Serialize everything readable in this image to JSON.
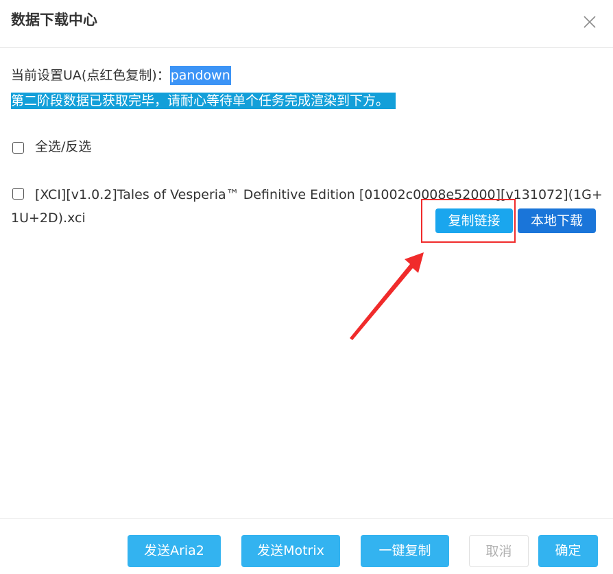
{
  "dialog": {
    "title": "数据下载中心"
  },
  "ua": {
    "label": "当前设置UA(点红色复制)：",
    "value": "pandown"
  },
  "status": {
    "message": "第二阶段数据已获取完毕，请耐心等待单个任务完成渲染到下方。"
  },
  "select_all": {
    "label": "全选/反选"
  },
  "files": [
    {
      "name": "[XCI][v1.0.2]Tales of Vesperia™ Definitive Edition [01002c0008e52000][v131072](1G+1U+2D).xci",
      "copy_link_label": "复制链接",
      "local_download_label": "本地下载"
    }
  ],
  "footer": {
    "aria2_label": "发送Aria2",
    "motrix_label": "发送Motrix",
    "copy_all_label": "一键复制",
    "cancel_label": "取消",
    "confirm_label": "确定"
  },
  "colors": {
    "ua_highlight": "#3c94f6",
    "status_highlight": "#139fd9",
    "copy_button": "#1aa6ee",
    "local_button": "#1a75d9",
    "footer_button": "#33b3f0",
    "annotation_red": "#f02b2b"
  },
  "icons": {
    "close": "close-icon",
    "annotation_arrow": "arrow-icon"
  }
}
